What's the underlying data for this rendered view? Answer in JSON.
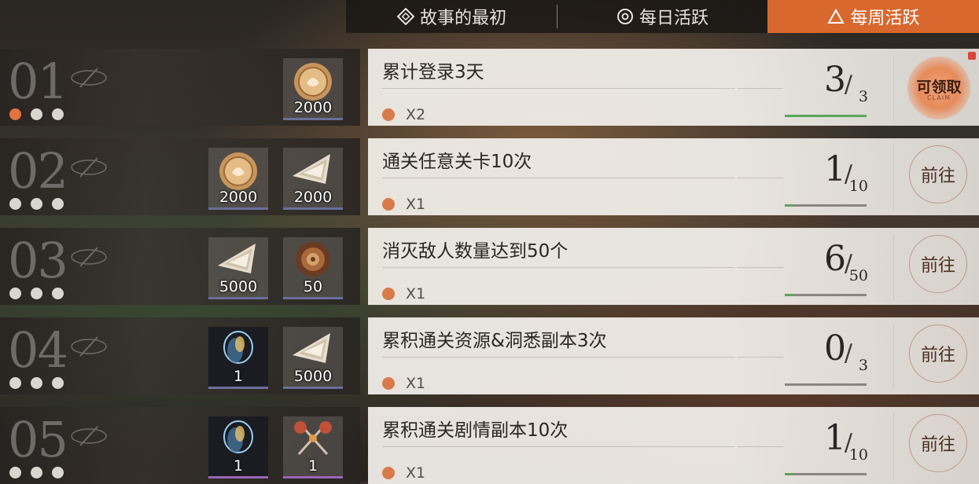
{
  "tabs": [
    {
      "label": "故事的最初",
      "icon": "diamond-icon"
    },
    {
      "label": "每日活跃",
      "icon": "target-icon"
    },
    {
      "label": "每周活跃",
      "icon": "triangle-icon",
      "active": true
    }
  ],
  "rows": [
    {
      "index": "01",
      "task": "累计登录3天",
      "multiplier": "X2",
      "progress": "3",
      "total": "3",
      "progress_fraction": 1.0,
      "action": "可领取",
      "action_sub": "CLAIM",
      "active_dot": 0,
      "rewards": [
        {
          "icon": "gold-coin-icon",
          "qty": "2000"
        }
      ]
    },
    {
      "index": "02",
      "task": "通关任意关卡10次",
      "multiplier": "X1",
      "progress": "1",
      "total": "10",
      "progress_fraction": 0.1,
      "action": "前往",
      "active_dot": -1,
      "rewards": [
        {
          "icon": "gold-coin-icon",
          "qty": "2000"
        },
        {
          "icon": "crystal-shard-icon",
          "qty": "2000"
        }
      ]
    },
    {
      "index": "03",
      "task": "消灭敌人数量达到50个",
      "multiplier": "X1",
      "progress": "6",
      "total": "50",
      "progress_fraction": 0.12,
      "action": "前往",
      "active_dot": -1,
      "rewards": [
        {
          "icon": "crystal-shard-icon",
          "qty": "5000"
        },
        {
          "icon": "ammonite-shell-icon",
          "qty": "50"
        }
      ]
    },
    {
      "index": "04",
      "task": "累积通关资源&洞悉副本3次",
      "multiplier": "X1",
      "progress": "0",
      "total": "3",
      "progress_fraction": 0,
      "action": "前往",
      "active_dot": -1,
      "rewards": [
        {
          "icon": "wisp-orb-icon",
          "qty": "1"
        },
        {
          "icon": "crystal-shard-icon",
          "qty": "5000"
        }
      ]
    },
    {
      "index": "05",
      "task": "累积通关剧情副本10次",
      "multiplier": "X1",
      "progress": "1",
      "total": "10",
      "progress_fraction": 0.1,
      "action": "前往",
      "active_dot": -1,
      "rewards": [
        {
          "icon": "wisp-orb-icon",
          "qty": "1"
        },
        {
          "icon": "crossed-keys-icon",
          "qty": "1"
        }
      ]
    }
  ],
  "colors": {
    "accent": "#d9682e",
    "progress_fill": "#5aa65a",
    "active_dot": "#e0733f",
    "badge": "#d9473a"
  }
}
